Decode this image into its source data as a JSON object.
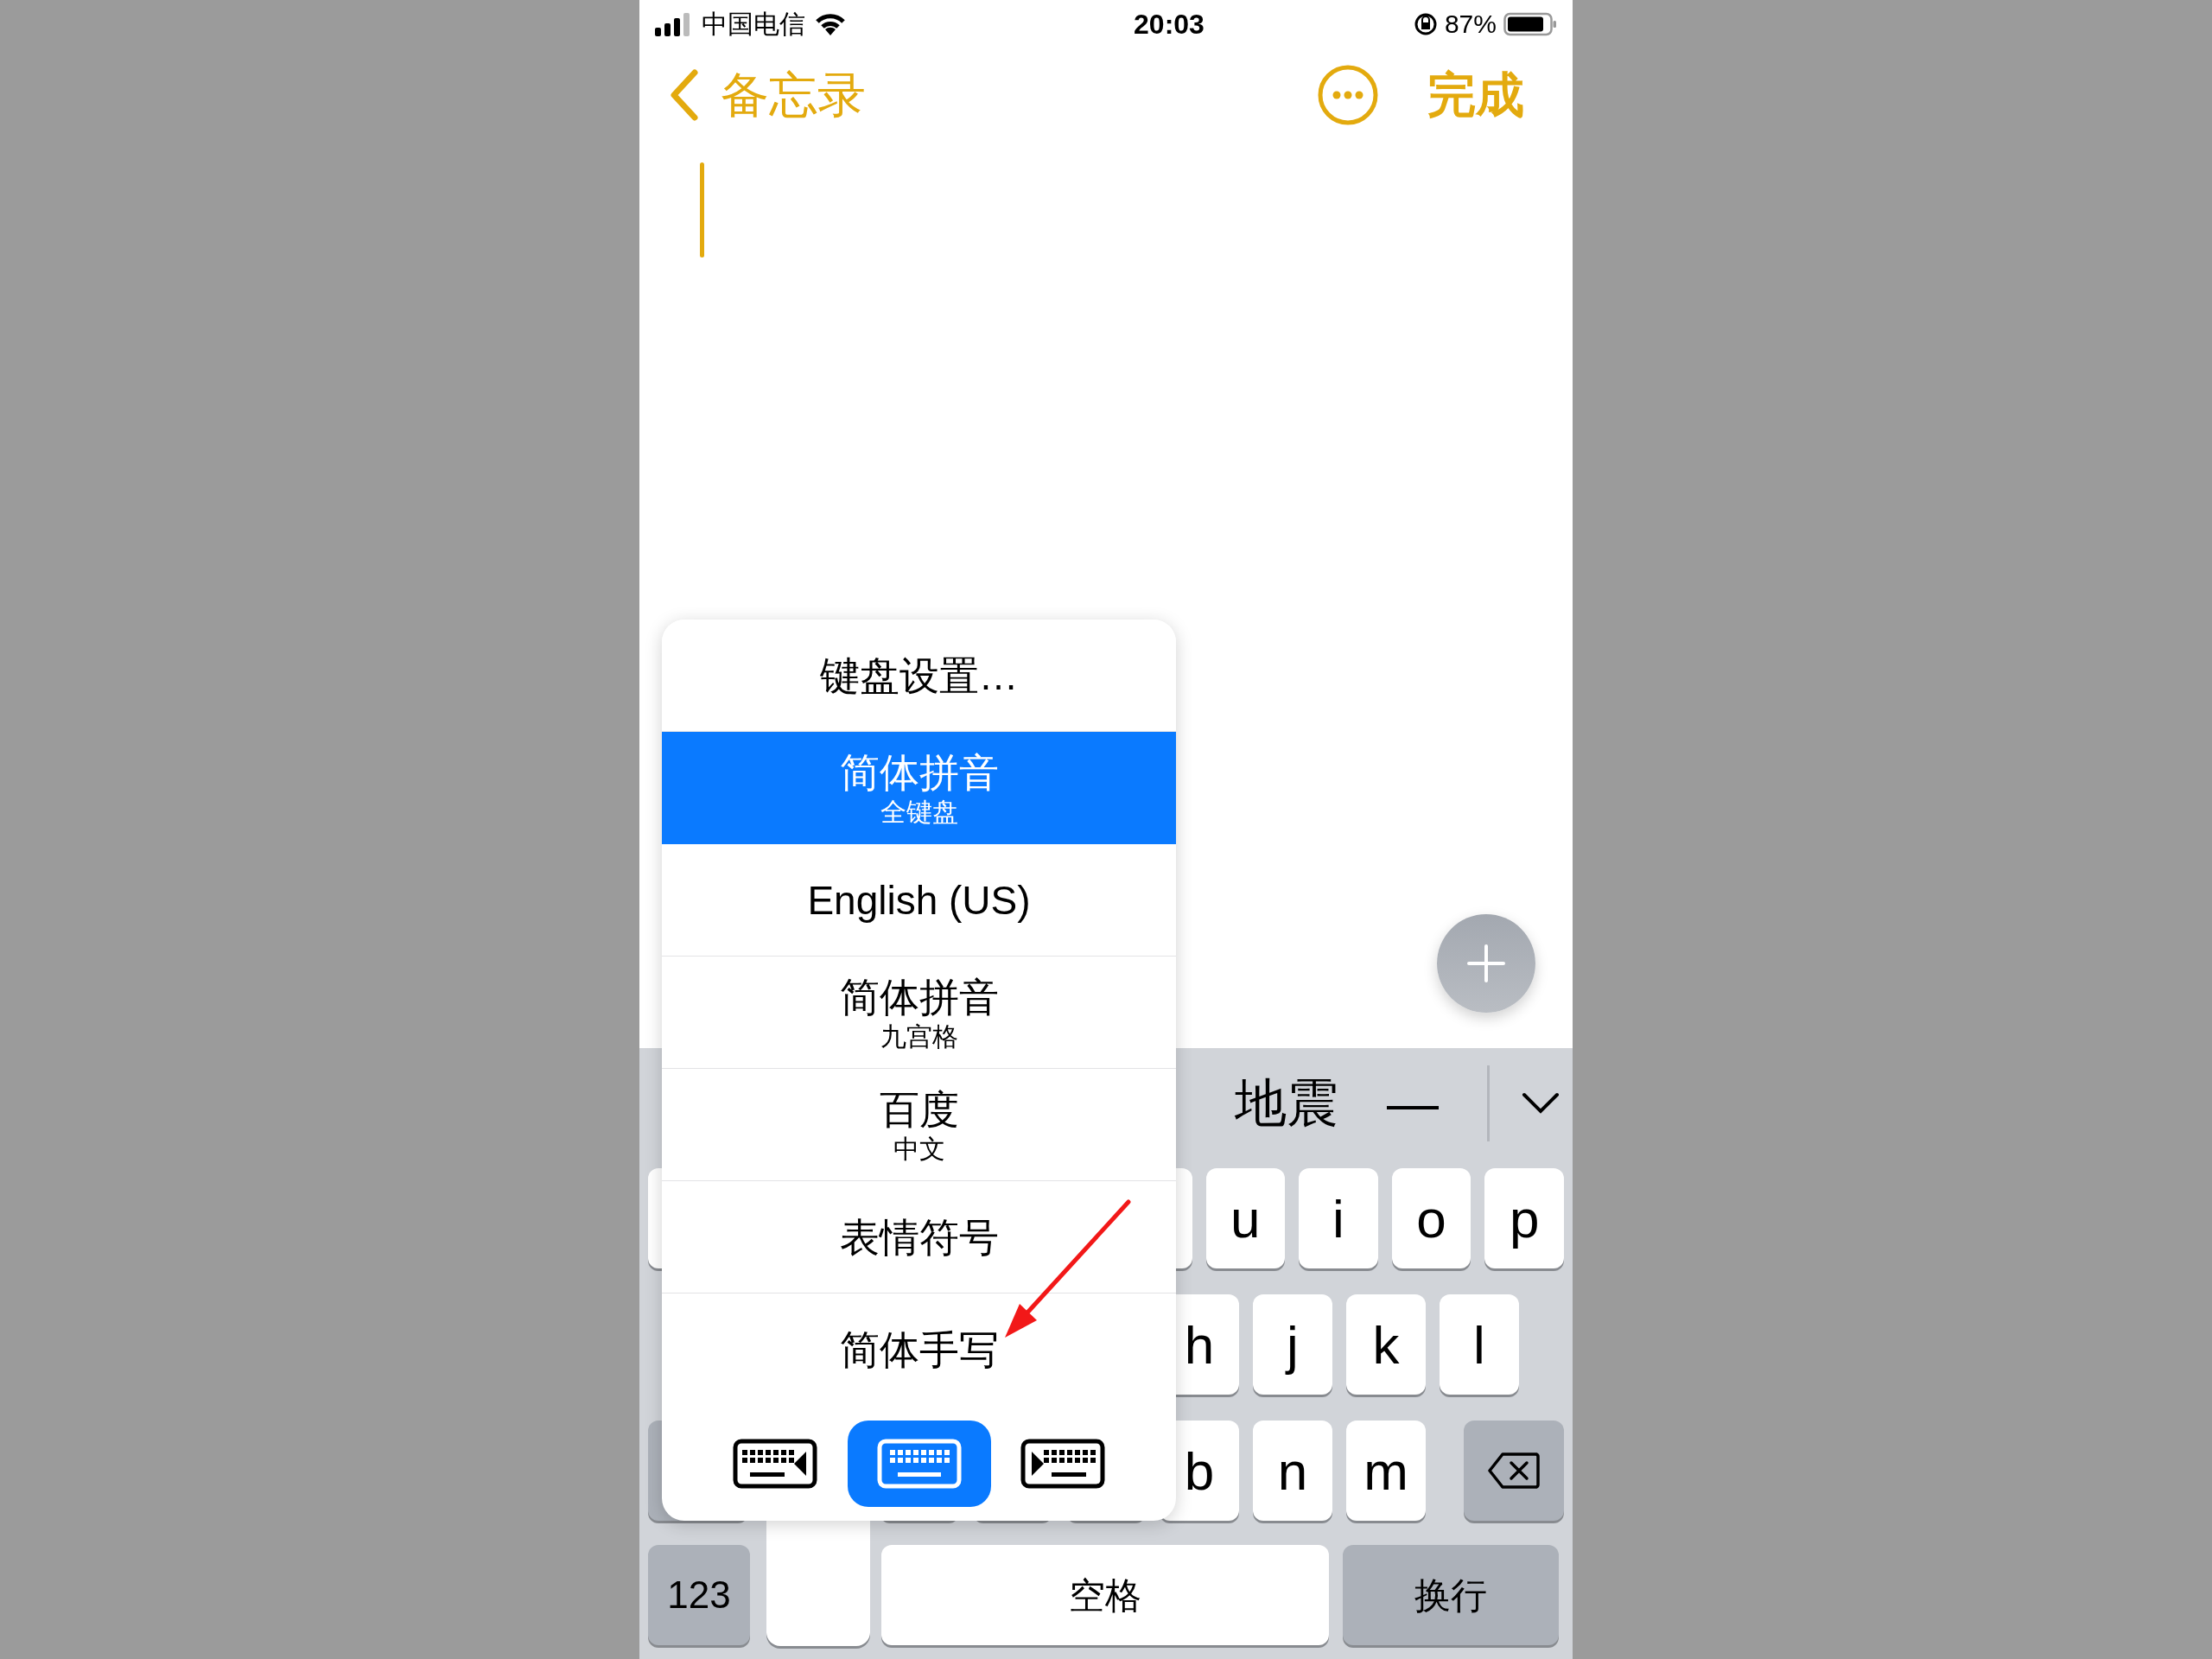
{
  "status_bar": {
    "carrier": "中国电信",
    "time": "20:03",
    "battery": "87%"
  },
  "nav": {
    "back_label": "备忘录",
    "done_label": "完成"
  },
  "candidates": [
    "地震",
    "—"
  ],
  "keyboard": {
    "row1": [
      "u",
      "i",
      "o",
      "p"
    ],
    "row2": [
      "h",
      "j",
      "k",
      "l"
    ],
    "row3": [
      "b",
      "n",
      "m"
    ],
    "numbers_key": "123",
    "space_key": "空格",
    "return_key": "换行"
  },
  "menu": {
    "items": [
      {
        "title": "键盘设置…",
        "selected": false
      },
      {
        "title": "简体拼音",
        "subtitle": "全键盘",
        "selected": true
      },
      {
        "title": "English (US)",
        "selected": false
      },
      {
        "title": "简体拼音",
        "subtitle": "九宫格",
        "selected": false
      },
      {
        "title": "百度",
        "subtitle": "中文",
        "selected": false
      },
      {
        "title": "表情符号",
        "selected": false
      },
      {
        "title": "简体手写",
        "selected": false
      }
    ],
    "modes": [
      {
        "kind": "left",
        "selected": false
      },
      {
        "kind": "full",
        "selected": true
      },
      {
        "kind": "right",
        "selected": false
      }
    ]
  }
}
